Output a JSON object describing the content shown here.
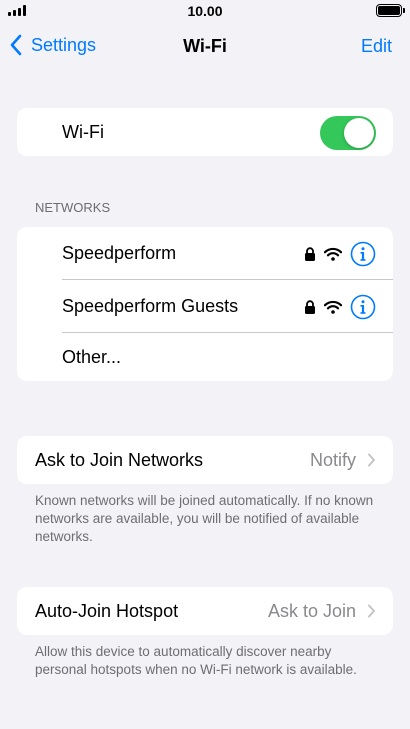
{
  "status_bar": {
    "time": "10.00"
  },
  "nav": {
    "back_label": "Settings",
    "title": "Wi-Fi",
    "edit_label": "Edit"
  },
  "wifi": {
    "label": "Wi-Fi",
    "enabled": true
  },
  "networks": {
    "header": "NETWORKS",
    "items": [
      {
        "name": "Speedperform",
        "secured": true
      },
      {
        "name": "Speedperform Guests",
        "secured": true
      }
    ],
    "other_label": "Other..."
  },
  "ask_to_join": {
    "label": "Ask to Join Networks",
    "value": "Notify",
    "footer": "Known networks will be joined automatically. If no known networks are available, you will be notified of available networks."
  },
  "auto_join": {
    "label": "Auto-Join Hotspot",
    "value": "Ask to Join",
    "footer": "Allow this device to automatically discover nearby personal hotspots when no Wi-Fi network is available."
  },
  "colors": {
    "accent": "#007aff",
    "toggle_on": "#34c759",
    "background": "#f2f2f7"
  },
  "icons": [
    "signal-icon",
    "battery-icon",
    "back-chevron-icon",
    "lock-icon",
    "wifi-icon",
    "info-icon",
    "chevron-right-icon"
  ]
}
